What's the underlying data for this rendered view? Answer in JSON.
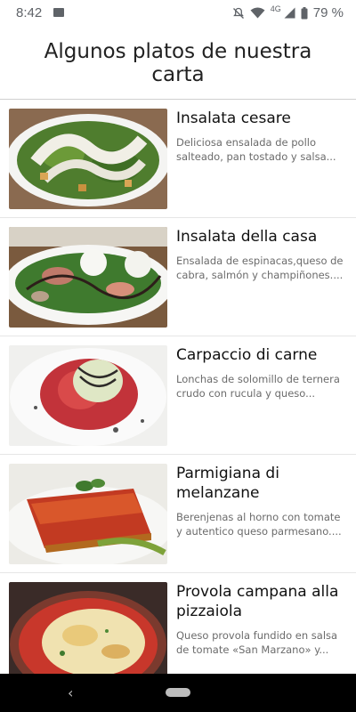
{
  "status_bar": {
    "time": "8:42",
    "network": "4G",
    "battery": "79 %",
    "icons": [
      "image-icon",
      "bell-off-icon",
      "wifi-icon",
      "signal-icon",
      "battery-icon"
    ]
  },
  "header": {
    "title": "Algunos platos de nuestra carta"
  },
  "dishes": [
    {
      "title": "Insalata cesare",
      "description": "Deliciosa ensalada de pollo salteado, pan tostado y salsa..."
    },
    {
      "title": "Insalata della casa",
      "description": "Ensalada de espinacas,queso de cabra, salmón y champiñones...."
    },
    {
      "title": "Carpaccio di carne",
      "description": "Lonchas de solomillo de ternera crudo con rucula y queso..."
    },
    {
      "title": "Parmigiana di melanzane",
      "description": "Berenjenas al horno con tomate y autentico queso parmesano...."
    },
    {
      "title": "Provola campana alla pizzaiola",
      "description": "Queso provola fundido en salsa de tomate «San Marzano» y..."
    }
  ],
  "nav": {
    "back_icon": "back-icon",
    "home_icon": "home-pill-icon"
  },
  "colors": {
    "text_primary": "#111111",
    "text_secondary": "#6b6b6b",
    "divider": "#cfcfcf",
    "nav_bg": "#000000"
  }
}
